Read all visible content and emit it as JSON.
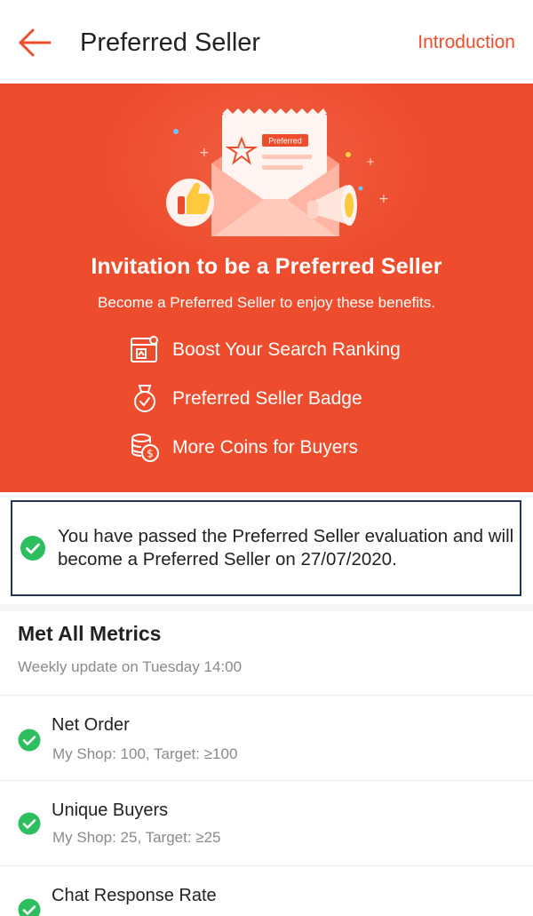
{
  "header": {
    "title": "Preferred Seller",
    "introduction_label": "Introduction"
  },
  "banner": {
    "illustration_text": "Preferred",
    "title": "Invitation to be a Preferred Seller",
    "subtitle": "Become a Preferred Seller to enjoy these benefits.",
    "benefits": [
      {
        "icon": "ranking-icon",
        "label": "Boost Your Search Ranking"
      },
      {
        "icon": "badge-icon",
        "label": "Preferred Seller Badge"
      },
      {
        "icon": "coins-icon",
        "label": "More Coins for Buyers"
      }
    ]
  },
  "notice": {
    "icon": "check-circle-icon",
    "text_part1": "You have passed the Preferred Seller evaluation and will become a Preferred Seller on ",
    "date": "27/07/2020."
  },
  "metrics": {
    "title": "Met All Metrics",
    "subtitle": "Weekly update on Tuesday 14:00",
    "items": [
      {
        "name": "Net Order",
        "detail": "My Shop: 100, Target: ≥100"
      },
      {
        "name": "Unique Buyers",
        "detail": "My Shop: 25, Target: ≥25"
      },
      {
        "name": "Chat Response Rate",
        "detail": ""
      }
    ]
  },
  "colors": {
    "brand": "#ee4d2d",
    "success": "#2dbe60",
    "notice_border": "#1f3456"
  }
}
